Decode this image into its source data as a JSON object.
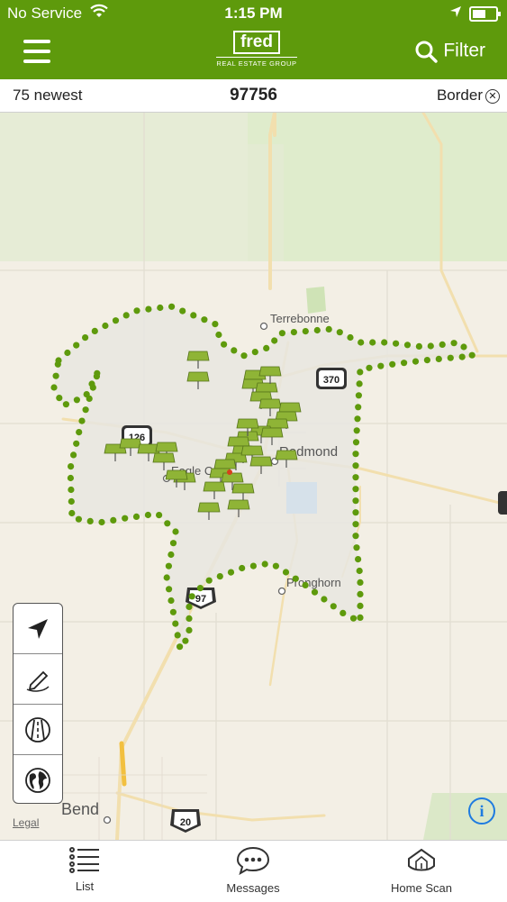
{
  "status_bar": {
    "carrier": "No Service",
    "time": "1:15 PM"
  },
  "header": {
    "logo_word": "fred",
    "logo_sub": "REAL ESTATE GROUP",
    "filter_label": "Filter"
  },
  "subbar": {
    "newest_label": "75 newest",
    "zip": "97756",
    "border_label": "Border"
  },
  "map": {
    "places": {
      "terrebonne": "Terrebonne",
      "redmond": "Redmond",
      "eagle_crest": "Eagle Cr",
      "pronghorn": "Pronghorn",
      "bend": "Bend"
    },
    "shields": {
      "hwy_370": "370",
      "hwy_126": "126",
      "hwy_97": "97",
      "hwy_20": "20"
    },
    "legal": "Legal",
    "info": "i",
    "colors": {
      "border_dots": "#5e9a0c",
      "pins": "#8fb436",
      "selected_pin": "#d6411b"
    },
    "tools": [
      "locate-icon",
      "draw-pencil-icon",
      "road-icon",
      "globe-icon"
    ]
  },
  "tabbar": {
    "tabs": [
      {
        "label": "List",
        "icon": "list-icon"
      },
      {
        "label": "Messages",
        "icon": "messages-icon"
      },
      {
        "label": "Home Scan",
        "icon": "home-scan-icon"
      }
    ]
  }
}
